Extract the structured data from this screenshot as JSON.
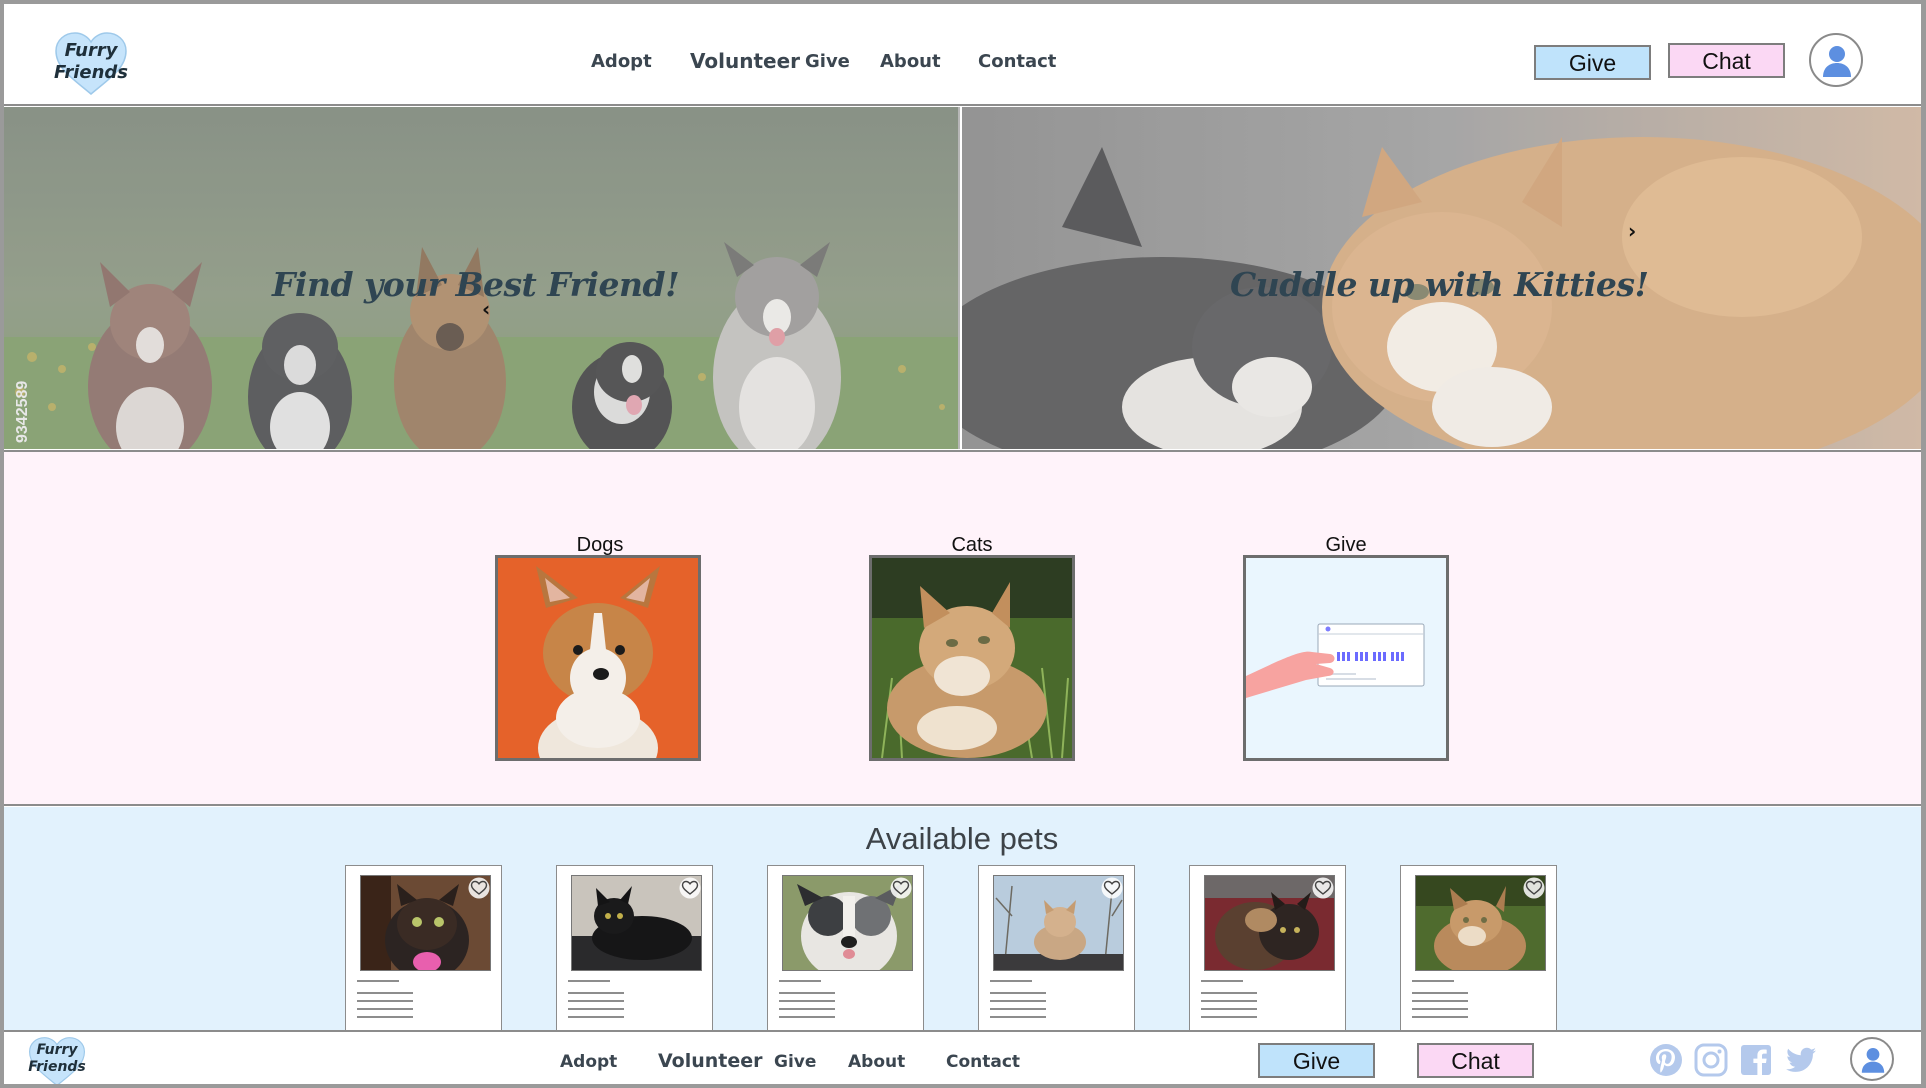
{
  "brand": {
    "line1": "Furry",
    "line2": "Friends"
  },
  "nav": {
    "adopt": "Adopt",
    "volunteer": "Volunteer",
    "give": "Give",
    "about": "About",
    "contact": "Contact"
  },
  "header_buttons": {
    "give": "Give",
    "chat": "Chat"
  },
  "hero": {
    "left_caption": "Find your Best Friend!",
    "right_caption": "Cuddle up with Kitties!",
    "prev_arrow": "‹",
    "next_arrow": "›",
    "stock_id": "9342589"
  },
  "categories": [
    {
      "label": "Dogs"
    },
    {
      "label": "Cats"
    },
    {
      "label": "Give"
    }
  ],
  "pets": {
    "title": "Available pets",
    "cards": [
      {
        "animal": "tortoiseshell cat"
      },
      {
        "animal": "black cat"
      },
      {
        "animal": "australian shepherd"
      },
      {
        "animal": "orange cat"
      },
      {
        "animal": "calico cat"
      },
      {
        "animal": "orange tabby cat"
      }
    ]
  },
  "footer": {
    "brand": {
      "line1": "Furry",
      "line2": "Friends"
    },
    "nav": {
      "adopt": "Adopt",
      "volunteer": "Volunteer",
      "give": "Give",
      "about": "About",
      "contact": "Contact"
    },
    "buttons": {
      "give": "Give",
      "chat": "Chat"
    },
    "social": [
      "pinterest-icon",
      "instagram-icon",
      "facebook-icon",
      "twitter-icon"
    ]
  },
  "colors": {
    "give_button": "#bfe3fb",
    "chat_button": "#fbd8f4",
    "categories_bg": "#fff3fa",
    "pets_bg": "#e2f2fd",
    "accent_blue": "#5d8fe0"
  }
}
